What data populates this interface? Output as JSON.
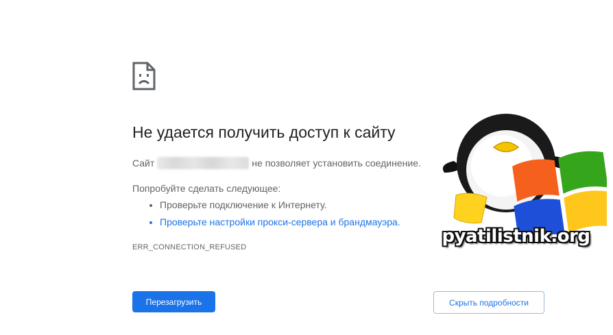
{
  "error": {
    "title": "Не удается получить доступ к сайту",
    "desc_prefix": "Сайт",
    "desc_suffix": "не позволяет установить соединение.",
    "suggest_label": "Попробуйте сделать следующее:",
    "suggestions": [
      "Проверьте подключение к Интернету.",
      "Проверьте настройки прокси-сервера и брандмауэра."
    ],
    "code": "ERR_CONNECTION_REFUSED"
  },
  "buttons": {
    "reload": "Перезагрузить",
    "details": "Скрыть подробности"
  },
  "watermark": {
    "text": "pyatilistnik.org"
  },
  "colors": {
    "accent": "#1a73e8",
    "title": "#202124",
    "body_text": "#5f6368"
  },
  "icons": {
    "error_icon": "sad-page-icon"
  }
}
